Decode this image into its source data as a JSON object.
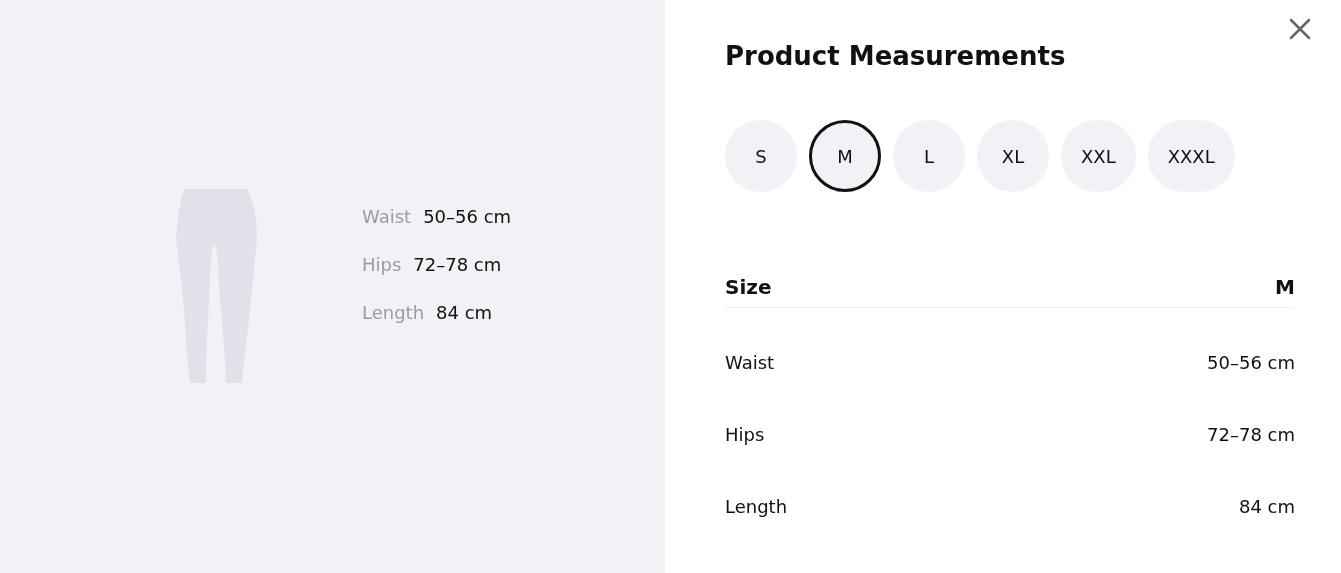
{
  "preview": {
    "measurements": [
      {
        "label": "Waist",
        "value": "50–56 cm"
      },
      {
        "label": "Hips",
        "value": "72–78 cm"
      },
      {
        "label": "Length",
        "value": "84 cm"
      }
    ]
  },
  "panel": {
    "title": "Product Measurements",
    "sizes": [
      {
        "label": "S",
        "selected": false
      },
      {
        "label": "M",
        "selected": true
      },
      {
        "label": "L",
        "selected": false
      },
      {
        "label": "XL",
        "selected": false
      },
      {
        "label": "XXL",
        "selected": false
      },
      {
        "label": "XXXL",
        "selected": false
      }
    ],
    "table": {
      "header": {
        "label": "Size",
        "value": "M"
      },
      "rows": [
        {
          "label": "Waist",
          "value": "50–56 cm"
        },
        {
          "label": "Hips",
          "value": "72–78 cm"
        },
        {
          "label": "Length",
          "value": "84 cm"
        }
      ]
    }
  }
}
